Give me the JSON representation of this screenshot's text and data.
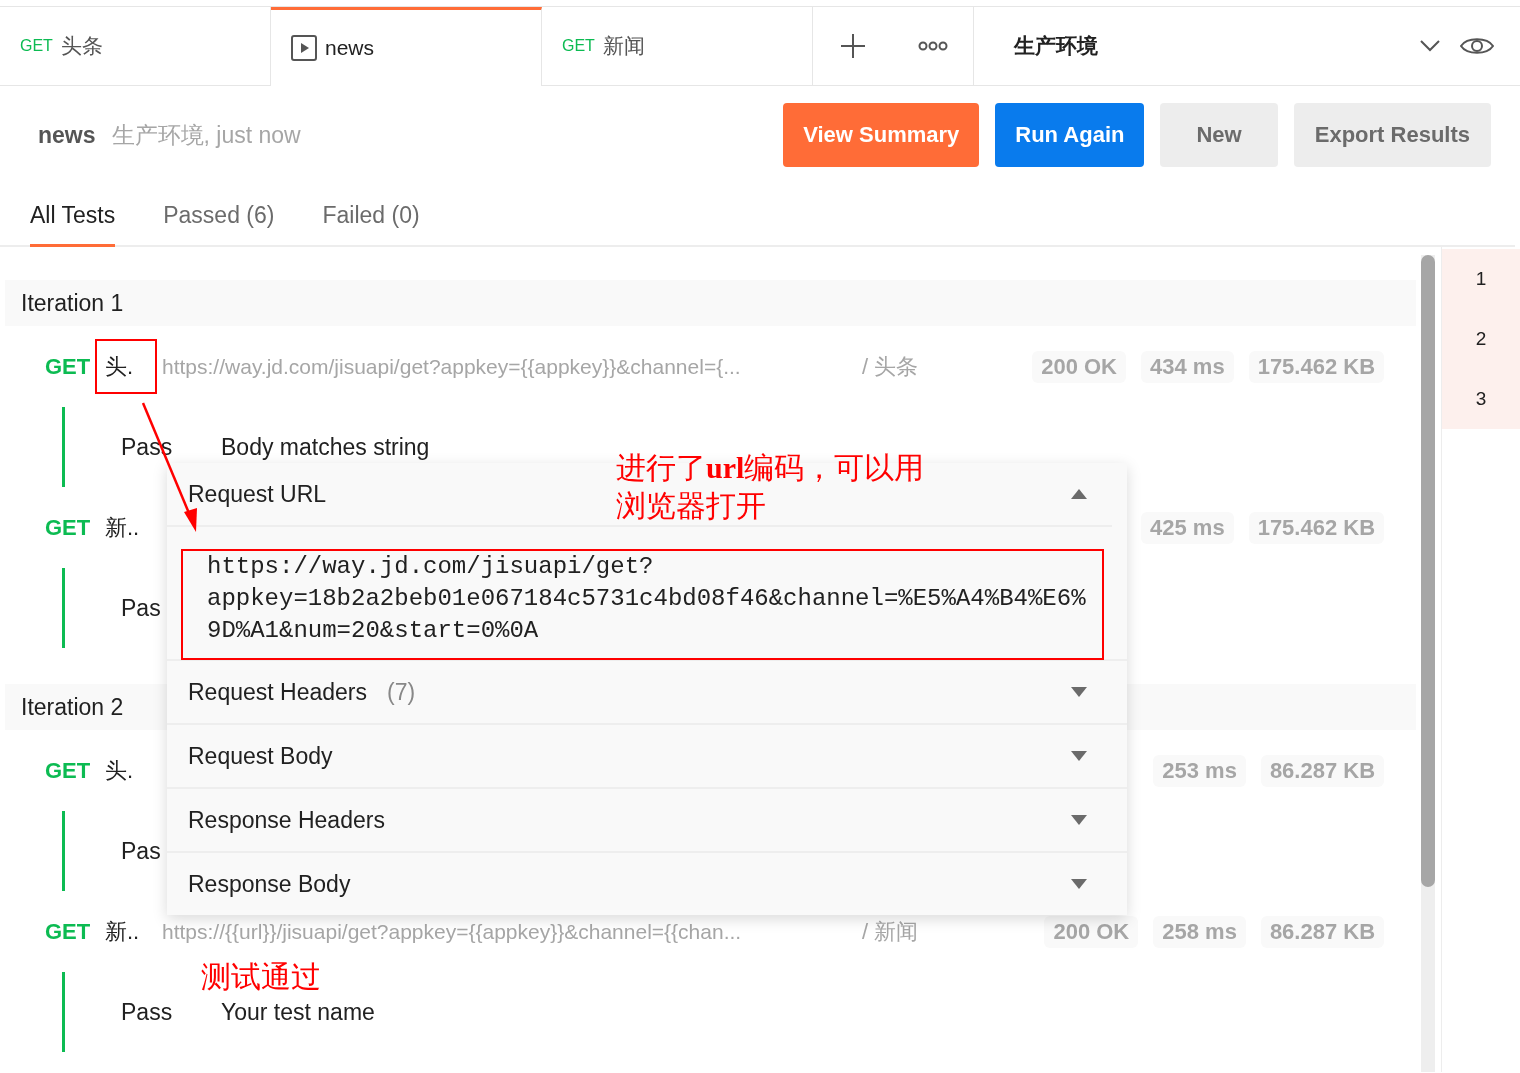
{
  "tabs": [
    {
      "kind": "request",
      "method": "GET",
      "label": "头条",
      "selected": false
    },
    {
      "kind": "runner",
      "label": "news",
      "selected": true
    },
    {
      "kind": "request",
      "method": "GET",
      "label": "新闻",
      "selected": false
    }
  ],
  "environment": "生产环境",
  "run": {
    "name": "news",
    "meta": "生产环境, just now"
  },
  "buttons": [
    {
      "label": "View Summary",
      "kind": "primary"
    },
    {
      "label": "Run Again",
      "kind": "accent"
    },
    {
      "label": "New",
      "kind": "plain"
    },
    {
      "label": "Export Results",
      "kind": "plain"
    }
  ],
  "result_tabs": [
    {
      "label": "All Tests",
      "selected": true
    },
    {
      "label": "Passed (6)",
      "selected": false
    },
    {
      "label": "Failed (0)",
      "selected": false
    }
  ],
  "iterations": [
    {
      "title": "Iteration 1",
      "requests": [
        {
          "method": "GET",
          "name": "头.",
          "url": "https://way.jd.com/jisuapi/get?appkey={{appkey}}&channel={...",
          "folder": "/ 头条",
          "status": "200 OK",
          "time": "434 ms",
          "size": "175.462 KB",
          "tests": [
            {
              "result": "Pass",
              "name": "Body matches string"
            }
          ]
        },
        {
          "method": "GET",
          "name": "新..",
          "time": "425 ms",
          "size": "175.462 KB",
          "tests": [
            {
              "result": "Pas"
            }
          ]
        }
      ]
    },
    {
      "title": "Iteration 2",
      "requests": [
        {
          "method": "GET",
          "name": "头.",
          "time": "253 ms",
          "size": "86.287 KB",
          "tests": [
            {
              "result": "Pas"
            }
          ]
        },
        {
          "method": "GET",
          "name": "新..",
          "url": "https://{{url}}/jisuapi/get?appkey={{appkey}}&channel={{chan...",
          "folder": "/ 新闻",
          "status": "200 OK",
          "time": "258 ms",
          "size": "86.287 KB",
          "tests": [
            {
              "result": "Pass",
              "name": "Your test name"
            }
          ]
        }
      ]
    }
  ],
  "iteration_numbers": [
    "1",
    "2",
    "3"
  ],
  "popup": {
    "sections": [
      {
        "title": "Request URL",
        "expanded": true,
        "content": "https://way.jd.com/jisuapi/get?appkey=18b2a2beb01e067184c5731c4bd08f46&channel=%E5%A4%B4%E6%9D%A1&num=20&start=0%0A"
      },
      {
        "title": "Request Headers",
        "count": "(7)",
        "expanded": false
      },
      {
        "title": "Request Body",
        "expanded": false
      },
      {
        "title": "Response Headers",
        "expanded": false
      },
      {
        "title": "Response Body",
        "expanded": false
      }
    ]
  },
  "annotations": [
    {
      "text": "进行了**url**编码，可以用浏览器打开"
    },
    {
      "text": "测试通过"
    }
  ]
}
